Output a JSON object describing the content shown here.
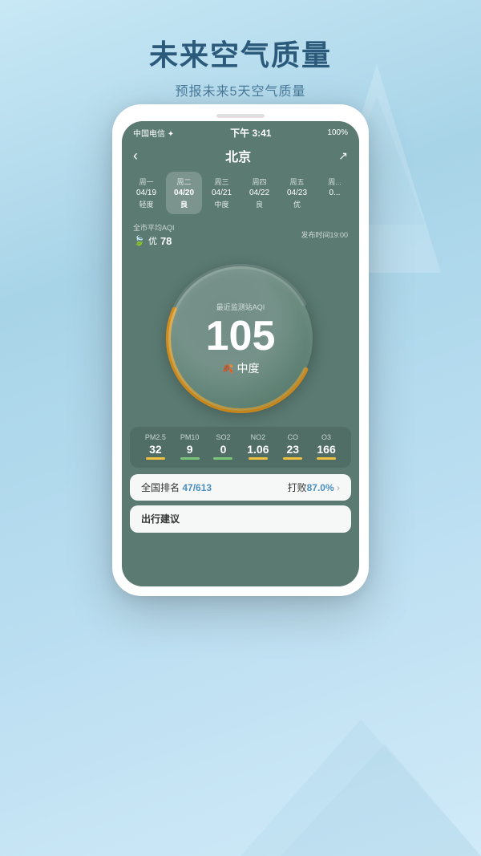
{
  "page": {
    "title": "未来空气质量",
    "subtitle": "预报未来5天空气质量",
    "background_color": "#b8daf0"
  },
  "status_bar": {
    "carrier": "中国电信 ✦",
    "time": "下午 3:41",
    "battery": "100%"
  },
  "nav": {
    "back": "‹",
    "title": "北京",
    "share": "↗"
  },
  "days": [
    {
      "weekday": "周一",
      "date": "04/19",
      "quality": "轻度",
      "active": false
    },
    {
      "weekday": "周二",
      "date": "04/20",
      "quality": "良",
      "active": true
    },
    {
      "weekday": "周三",
      "date": "04/21",
      "quality": "中度",
      "active": false
    },
    {
      "weekday": "周四",
      "date": "04/22",
      "quality": "良",
      "active": false
    },
    {
      "weekday": "周五",
      "date": "04/23",
      "quality": "优",
      "active": false
    },
    {
      "weekday": "周...",
      "date": "0...",
      "quality": "",
      "active": false
    }
  ],
  "aqi_info": {
    "label": "全市平均AQI",
    "quality": "优",
    "value": "78",
    "publish_time": "发布时间19:00"
  },
  "gauge": {
    "station_label": "最近监测站AQI",
    "value": "105",
    "quality": "中度"
  },
  "pollutants": [
    {
      "name": "PM2.5",
      "value": "32",
      "bar_color": "yellow"
    },
    {
      "name": "PM10",
      "value": "9",
      "bar_color": "green"
    },
    {
      "name": "SO2",
      "value": "0",
      "bar_color": "green"
    },
    {
      "name": "NO2",
      "value": "1.06",
      "bar_color": "yellow"
    },
    {
      "name": "CO",
      "value": "23",
      "bar_color": "yellow"
    },
    {
      "name": "O3",
      "value": "166",
      "bar_color": "yellow"
    }
  ],
  "ranking": {
    "label": "全国排名",
    "rank": "47/613",
    "defeat_label": "打败",
    "defeat_pct": "87.0%"
  },
  "suggest": {
    "label": "出行建议"
  }
}
